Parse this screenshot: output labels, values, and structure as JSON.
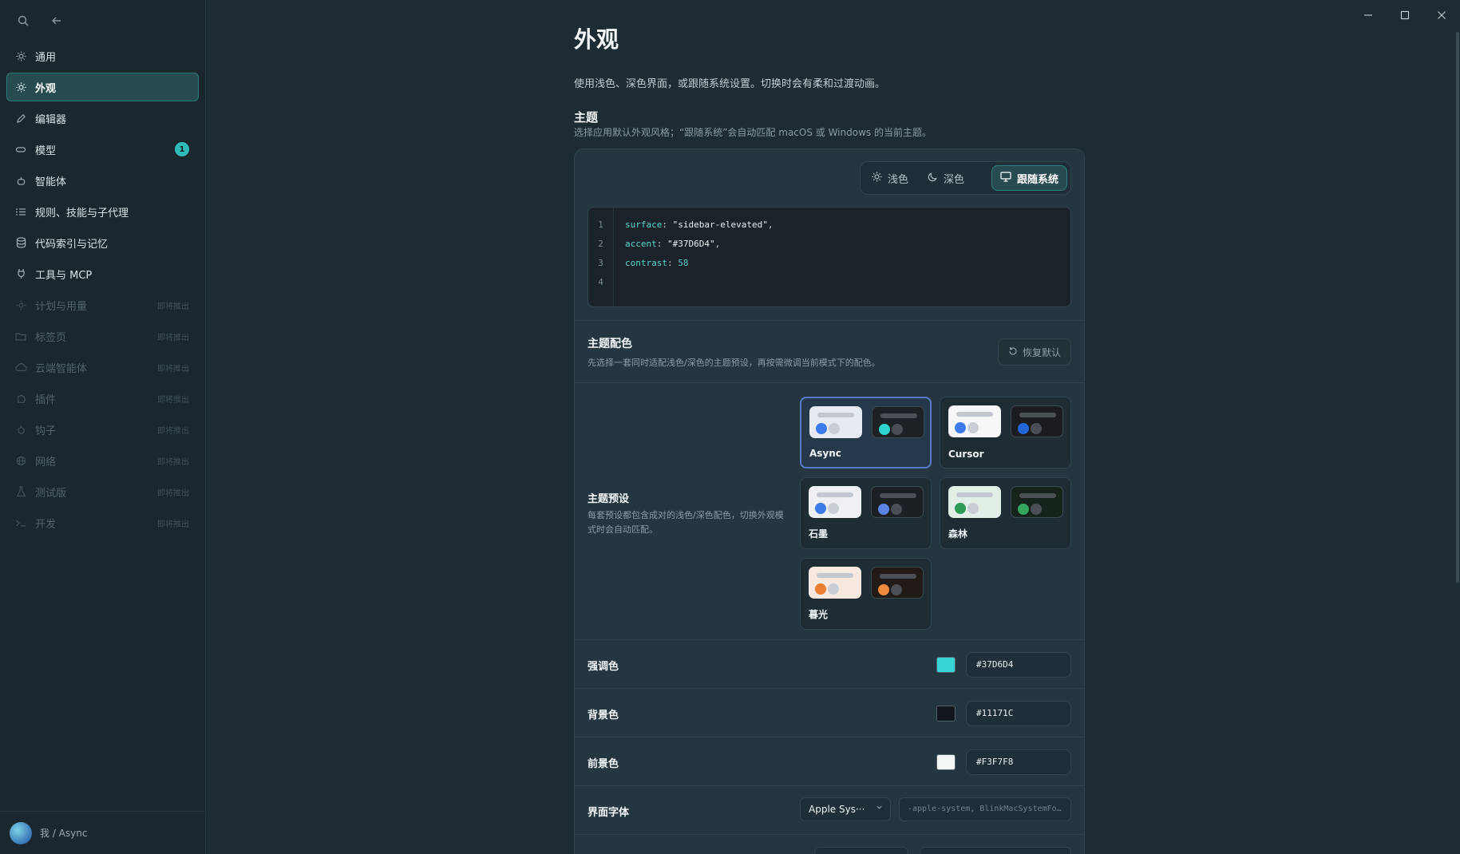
{
  "sidebar": {
    "items": [
      {
        "label": "通用",
        "icon": "sun-icon",
        "state": "normal"
      },
      {
        "label": "外观",
        "icon": "sun-icon",
        "state": "active"
      },
      {
        "label": "编辑器",
        "icon": "pencil-icon",
        "state": "normal"
      },
      {
        "label": "模型",
        "icon": "chip-icon",
        "state": "normal",
        "badge": "1"
      },
      {
        "label": "智能体",
        "icon": "bot-icon",
        "state": "normal"
      },
      {
        "label": "规则、技能与子代理",
        "icon": "list-icon",
        "state": "normal"
      },
      {
        "label": "代码索引与记忆",
        "icon": "database-icon",
        "state": "normal"
      },
      {
        "label": "工具与 MCP",
        "icon": "plug-icon",
        "state": "normal"
      },
      {
        "label": "计划与用量",
        "icon": "gauge-icon",
        "state": "disabled",
        "soon": "即将推出"
      },
      {
        "label": "标签页",
        "icon": "folder-icon",
        "state": "disabled",
        "soon": "即将推出"
      },
      {
        "label": "云端智能体",
        "icon": "cloud-icon",
        "state": "disabled",
        "soon": "即将推出"
      },
      {
        "label": "插件",
        "icon": "puzzle-icon",
        "state": "disabled",
        "soon": "即将推出"
      },
      {
        "label": "钩子",
        "icon": "hook-icon",
        "state": "disabled",
        "soon": "即将推出"
      },
      {
        "label": "网络",
        "icon": "globe-icon",
        "state": "disabled",
        "soon": "即将推出"
      },
      {
        "label": "测试版",
        "icon": "flask-icon",
        "state": "disabled",
        "soon": "即将推出"
      },
      {
        "label": "开发",
        "icon": "terminal-icon",
        "state": "disabled",
        "soon": "即将推出"
      }
    ],
    "footer_user": "我 / Async"
  },
  "page": {
    "title": "外观",
    "description": "使用浅色、深色界面，或跟随系统设置。切换时会有柔和过渡动画。"
  },
  "theme": {
    "title": "主题",
    "description": "选择应用默认外观风格；“跟随系统”会自动匹配 macOS 或 Windows 的当前主题。",
    "options": [
      {
        "label": "浅色",
        "icon": "sun-icon"
      },
      {
        "label": "深色",
        "icon": "moon-icon"
      },
      {
        "label": "跟随系统",
        "icon": "monitor-icon"
      }
    ],
    "selected": "跟随系统"
  },
  "code_preview": {
    "line_numbers": [
      "1",
      "2",
      "3",
      "4"
    ],
    "lines": [
      {
        "key": "surface",
        "value": "\"sidebar-elevated\"",
        "trail": ","
      },
      {
        "key": "accent",
        "value": "\"#37D6D4\"",
        "trail": ","
      },
      {
        "key": "contrast",
        "value": "58",
        "trail": ""
      }
    ]
  },
  "palette": {
    "title": "主题配色",
    "description": "先选择一套同时适配浅色/深色的主题预设，再按需微调当前模式下的配色。",
    "reset_label": "恢复默认",
    "preset_label": "主题预设",
    "preset_description": "每套预设都包含成对的浅色/深色配色，切换外观模式时会自动匹配。",
    "presets": [
      {
        "name": "Async",
        "selected": true,
        "light_bg": "#e6ebf3",
        "dark_bg": "#1b2125",
        "light_dot": "#3e7bea",
        "dark_dot": "#2ed3cf"
      },
      {
        "name": "Cursor",
        "selected": false,
        "light_bg": "#f6f7f9",
        "dark_bg": "#1a1c1f",
        "light_dot": "#3e7bea",
        "dark_dot": "#2366d8"
      },
      {
        "name": "石墨",
        "selected": false,
        "light_bg": "#eef0f4",
        "dark_bg": "#1c1f24",
        "light_dot": "#3e7bea",
        "dark_dot": "#5b84e6"
      },
      {
        "name": "森林",
        "selected": false,
        "light_bg": "#e2efe6",
        "dark_bg": "#17241c",
        "light_dot": "#2e9b57",
        "dark_dot": "#34a65e"
      },
      {
        "name": "暮光",
        "selected": false,
        "light_bg": "#f7e9df",
        "dark_bg": "#221a17",
        "light_dot": "#ea7e33",
        "dark_dot": "#ee8a3d"
      }
    ]
  },
  "colors": {
    "accent": {
      "label": "强调色",
      "value": "#37D6D4"
    },
    "background": {
      "label": "背景色",
      "value": "#11171C"
    },
    "foreground": {
      "label": "前景色",
      "value": "#F3F7F8"
    }
  },
  "font": {
    "label": "界面字体",
    "selected": "Apple Sys···",
    "stack": "-apple-system, BlinkMacSystemFo…"
  }
}
